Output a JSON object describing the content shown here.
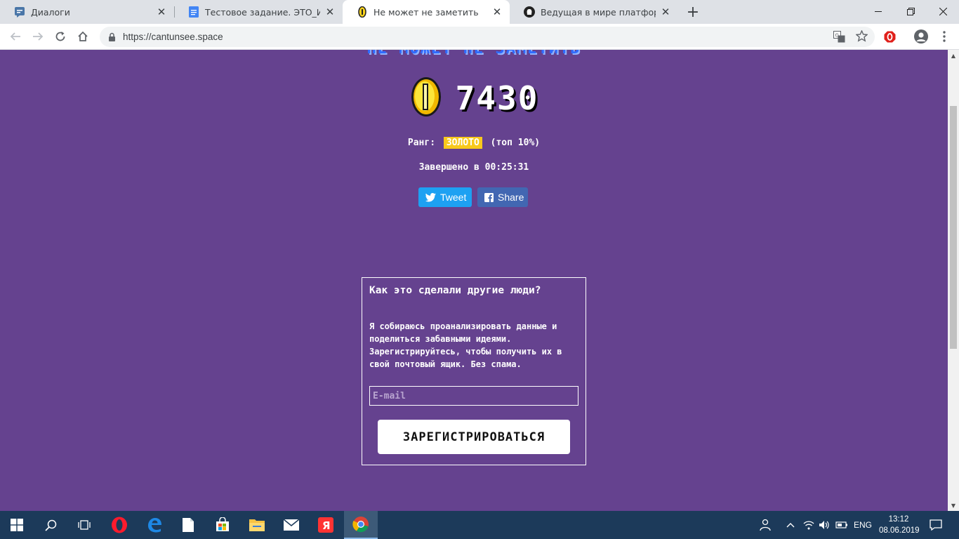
{
  "browser": {
    "tabs": [
      {
        "title": "Диалоги",
        "icon": "chat-icon"
      },
      {
        "title": "Тестовое задание. ЭТО_Инкубат",
        "icon": "docs-icon"
      },
      {
        "title": "Не может не заметить",
        "icon": "coin-icon",
        "active": true
      },
      {
        "title": "Ведущая в мире платформа для",
        "icon": "github-icon"
      }
    ],
    "url": "https://cantunsee.space"
  },
  "page": {
    "heading": "НЕ МОЖЕТ НЕ ЗАМЕТИТЬ",
    "score": "7430",
    "rank_label": "Ранг:",
    "rank_value": "ЗОЛОТО",
    "rank_note": "(топ 10%)",
    "completed": "Завершено в 00:25:31",
    "tweet_label": "Tweet",
    "share_label": "Share",
    "signup": {
      "title": "Как это сделали другие люди?",
      "text": "Я собираюсь проанализировать данные и поделиться забавными идеями. Зарегистрируйтесь, чтобы получить их в свой почтовый ящик. Без спама.",
      "email_placeholder": "E-mail",
      "button": "ЗАРЕГИСТРИРОВАТЬСЯ"
    }
  },
  "taskbar": {
    "language": "ENG",
    "time": "13:12",
    "date": "08.06.2019"
  },
  "colors": {
    "page_bg": "#65428f",
    "rank_badge": "#f8c91c",
    "twitter": "#1da1f2",
    "facebook": "#4267b2"
  }
}
